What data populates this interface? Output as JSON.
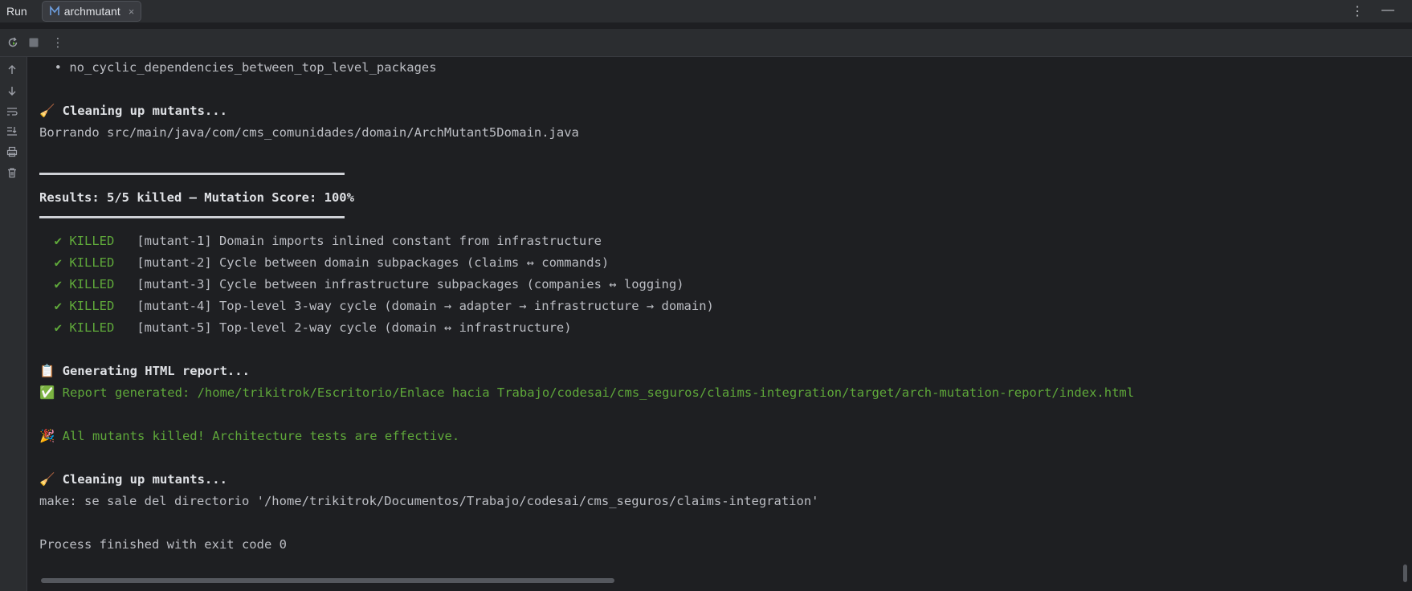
{
  "window": {
    "run_label": "Run",
    "tab_label": "archmutant",
    "tab_close": "×",
    "more_glyph": "⋮",
    "minimize_glyph": "—"
  },
  "toolbar": {
    "rerun_icon": "rerun-icon",
    "stop_icon": "stop-icon",
    "more_glyph": "⋮"
  },
  "gutter": {
    "icons": [
      "arrow-up-icon",
      "arrow-down-icon",
      "soft-wrap-icon",
      "scroll-to-end-icon",
      "print-icon",
      "trash-icon"
    ]
  },
  "console": {
    "line_bullet": "  • no_cyclic_dependencies_between_top_level_packages",
    "cleanup_1": "🧹 Cleaning up mutants...",
    "borrando": "Borrando src/main/java/com/cms_comunidades/domain/ArchMutant5Domain.java",
    "results": "Results: 5/5 killed — Mutation Score: 100%",
    "killed_status": "✔ KILLED",
    "mutants": [
      "[mutant-1] Domain imports inlined constant from infrastructure",
      "[mutant-2] Cycle between domain subpackages (claims ↔ commands)",
      "[mutant-3] Cycle between infrastructure subpackages (companies ↔ logging)",
      "[mutant-4] Top-level 3-way cycle (domain → adapter → infrastructure → domain)",
      "[mutant-5] Top-level 2-way cycle (domain ↔ infrastructure)"
    ],
    "generating": "📋 Generating HTML report...",
    "report": "✅ Report generated: /home/trikitrok/Escritorio/Enlace hacia Trabajo/codesai/cms_seguros/claims-integration/target/arch-mutation-report/index.html",
    "all_killed": "🎉 All mutants killed! Architecture tests are effective.",
    "cleanup_2": "🧹 Cleaning up mutants...",
    "make": "make: se sale del directorio '/home/trikitrok/Documentos/Trabajo/codesai/cms_seguros/claims-integration'",
    "process": "Process finished with exit code 0"
  },
  "colors": {
    "background": "#1e1f22",
    "panel": "#2b2d30",
    "text": "#bcbec4",
    "success_green": "#5fa83a"
  }
}
